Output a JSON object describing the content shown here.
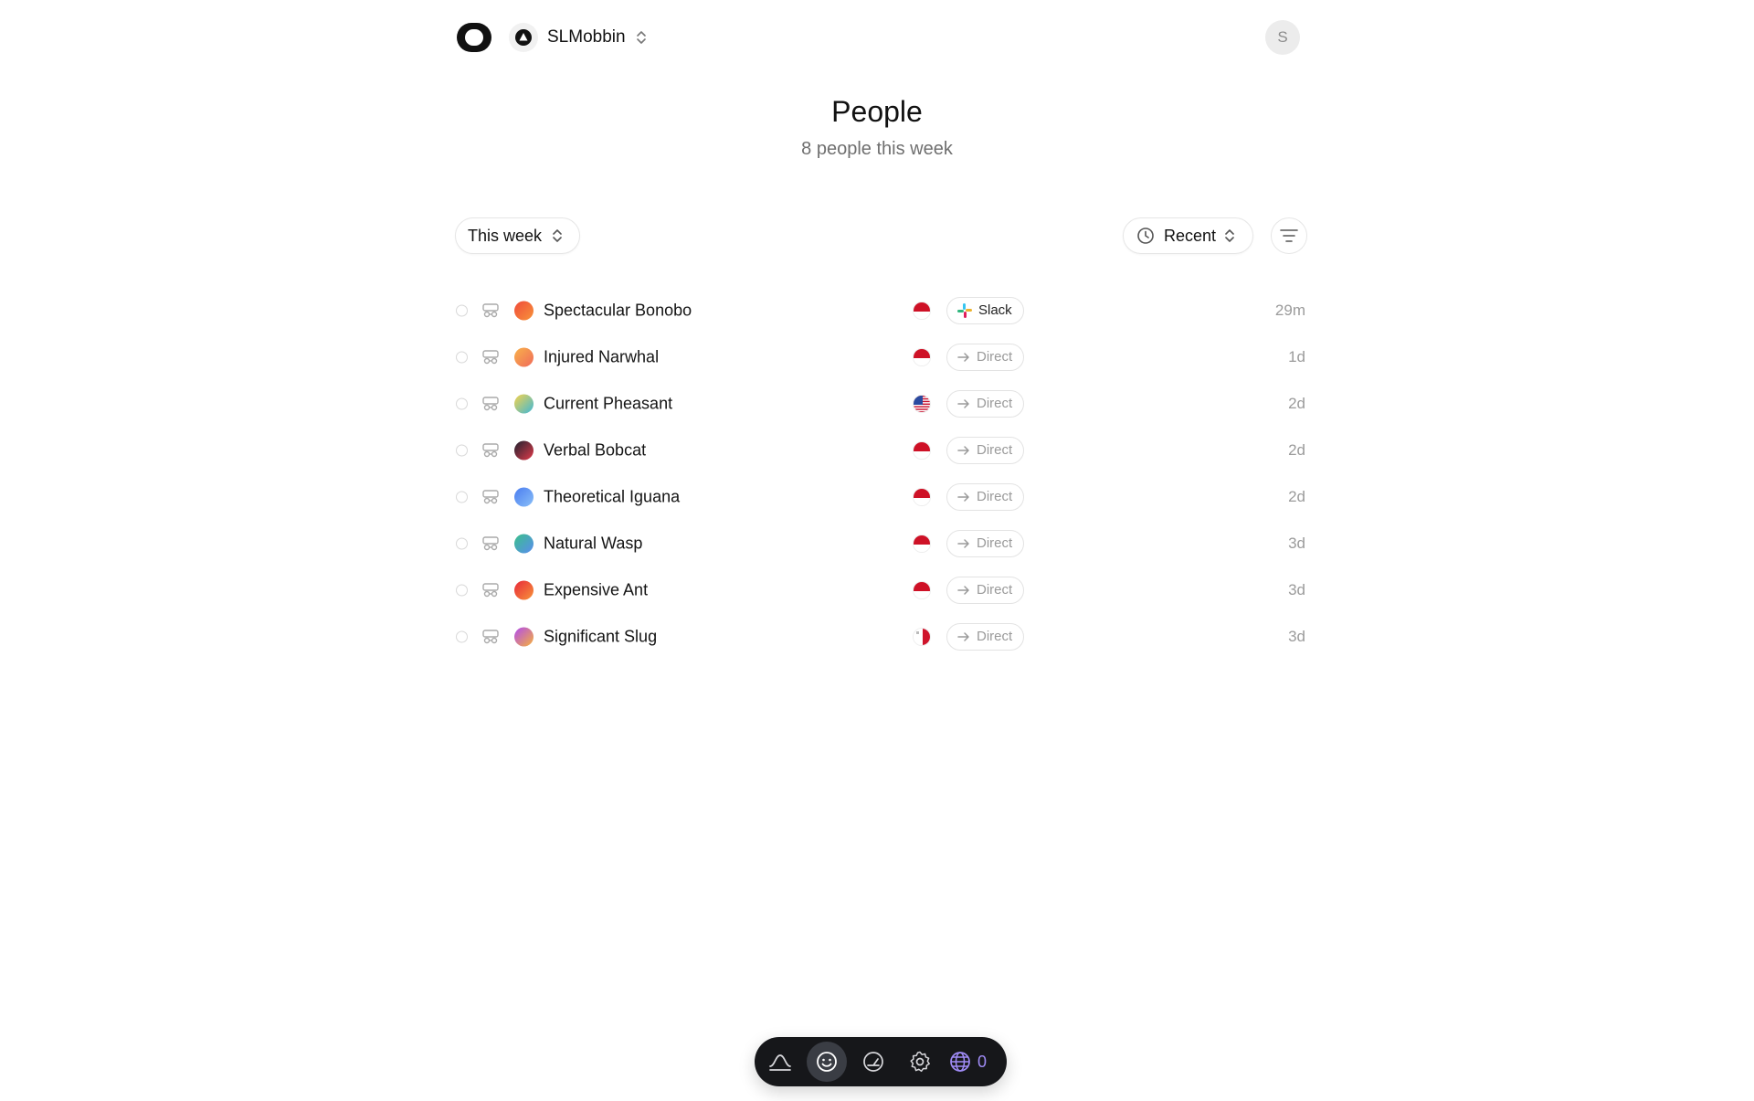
{
  "header": {
    "workspace_name": "SLMobbin",
    "user_initial": "S"
  },
  "page": {
    "title": "People",
    "subtitle": "8 people this week"
  },
  "controls": {
    "period_label": "This week",
    "sort_label": "Recent"
  },
  "people": [
    {
      "name": "Spectacular Bonobo",
      "flag": "indonesia",
      "source": "Slack",
      "time": "29m",
      "colors": [
        "#f04a3a",
        "#f7943a"
      ]
    },
    {
      "name": "Injured Narwhal",
      "flag": "indonesia",
      "source": "Direct",
      "time": "1d",
      "colors": [
        "#f8b24a",
        "#f06a5a"
      ]
    },
    {
      "name": "Current Pheasant",
      "flag": "usa",
      "source": "Direct",
      "time": "2d",
      "colors": [
        "#f5d24a",
        "#3fb8d8"
      ]
    },
    {
      "name": "Verbal Bobcat",
      "flag": "indonesia",
      "source": "Direct",
      "time": "2d",
      "colors": [
        "#1e2230",
        "#e23a4a"
      ]
    },
    {
      "name": "Theoretical Iguana",
      "flag": "indonesia",
      "source": "Direct",
      "time": "2d",
      "colors": [
        "#4a7cf0",
        "#8ac0f8"
      ]
    },
    {
      "name": "Natural Wasp",
      "flag": "indonesia",
      "source": "Direct",
      "time": "3d",
      "colors": [
        "#3ac08a",
        "#5a8cf0"
      ]
    },
    {
      "name": "Expensive Ant",
      "flag": "indonesia",
      "source": "Direct",
      "time": "3d",
      "colors": [
        "#e8283a",
        "#f7943a"
      ]
    },
    {
      "name": "Significant Slug",
      "flag": "malta",
      "source": "Direct",
      "time": "3d",
      "colors": [
        "#b04af0",
        "#f7b23a"
      ]
    }
  ],
  "dock": {
    "items": [
      "pulse-icon",
      "smiley-icon",
      "gauge-icon",
      "gear-icon",
      "globe-icon"
    ],
    "active": "smiley-icon",
    "visitor_count": "0"
  },
  "colors": {
    "accent": "#a08cf7",
    "dock_bg": "#16171a",
    "muted_text": "#9b9b9b"
  }
}
